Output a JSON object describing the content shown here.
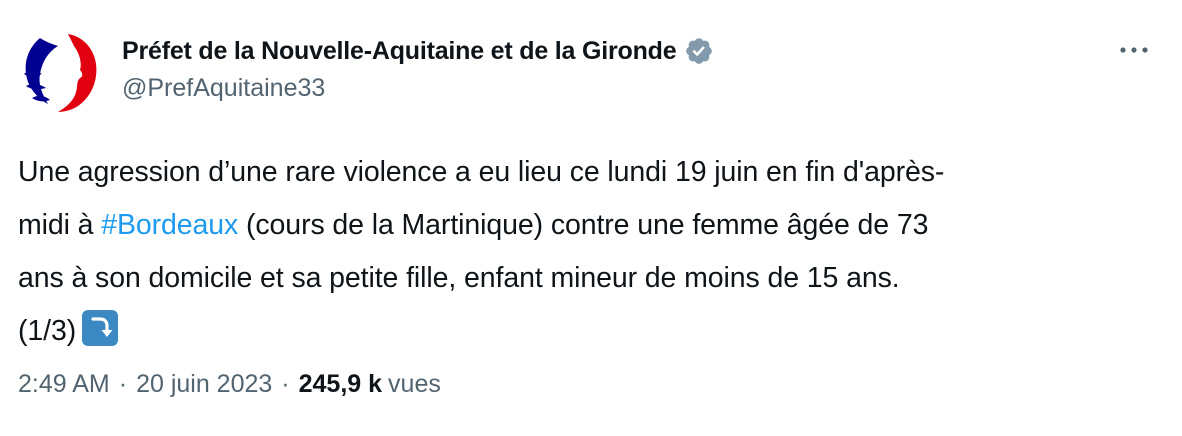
{
  "author": {
    "display_name": "Préfet de la Nouvelle-Aquitaine et de la Gironde",
    "handle": "@PrefAquitaine33",
    "avatar_icon": "marianne-logo",
    "verified_badge_icon": "verified-gray-badge",
    "verified_color": "#829aab"
  },
  "more_icon": "ellipsis-icon",
  "tweet": {
    "line1": "Une agression d’une rare violence a eu lieu ce lundi 19 juin en fin d'après-",
    "line2_prefix": "midi à ",
    "hashtag": "#Bordeaux",
    "line2_suffix": " (cours de la Martinique) contre une femme âgée de 73",
    "line3": "ans à son domicile et sa petite fille, enfant mineur de moins de 15 ans.",
    "line4": "(1/3)",
    "emoji": "right-arrow-curving-down-emoji",
    "hashtag_color": "#1d9bf0"
  },
  "meta": {
    "time": "2:49 AM",
    "separator": "·",
    "date": "20 juin 2023",
    "views_count": "245,9 k",
    "views_label": "vues"
  }
}
